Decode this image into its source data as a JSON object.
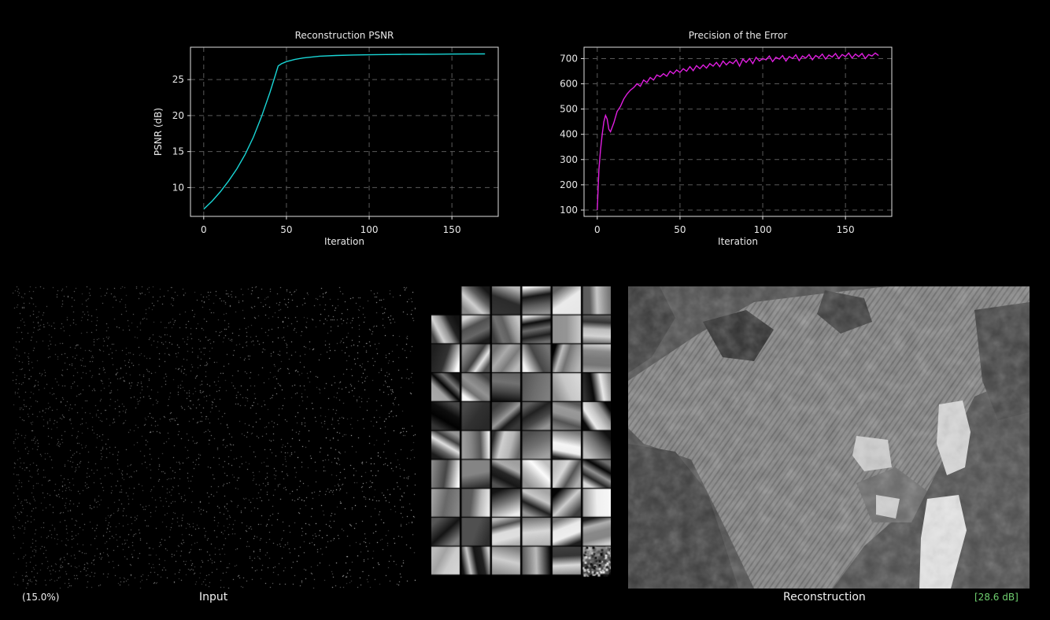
{
  "colors": {
    "psnr_line": "#19d6d6",
    "precision_line": "#e01ee0",
    "psnr_value_text": "#6fcf6f"
  },
  "chart_data": [
    {
      "type": "line",
      "title": "Reconstruction PSNR",
      "xlabel": "Iteration",
      "ylabel": "PSNR (dB)",
      "xlim": [
        -8,
        178
      ],
      "ylim": [
        6,
        29.5
      ],
      "xticks": [
        0,
        50,
        100,
        150
      ],
      "yticks": [
        10,
        15,
        20,
        25
      ],
      "grid": true,
      "series": [
        {
          "x": [
            0,
            5,
            10,
            15,
            20,
            25,
            30,
            35,
            40,
            43,
            45,
            47,
            50,
            55,
            60,
            70,
            80,
            90,
            100,
            110,
            120,
            130,
            140,
            150,
            160,
            170
          ],
          "y": [
            7,
            8.1,
            9.4,
            10.9,
            12.6,
            14.6,
            17.0,
            19.9,
            23.2,
            25.4,
            26.9,
            27.2,
            27.5,
            27.8,
            28.0,
            28.25,
            28.35,
            28.42,
            28.45,
            28.48,
            28.5,
            28.52,
            28.53,
            28.55,
            28.56,
            28.57
          ]
        }
      ]
    },
    {
      "type": "line",
      "title": "Precision of the Error",
      "xlabel": "Iteration",
      "ylabel": "",
      "xlim": [
        -8,
        178
      ],
      "ylim": [
        75,
        745
      ],
      "xticks": [
        0,
        50,
        100,
        150
      ],
      "yticks": [
        100,
        200,
        300,
        400,
        500,
        600,
        700
      ],
      "grid": true,
      "series": [
        {
          "x": [
            0,
            1,
            2,
            3,
            4,
            5,
            6,
            7,
            8,
            10,
            12,
            14,
            16,
            18,
            20,
            22,
            24,
            26,
            28,
            30,
            32,
            34,
            36,
            38,
            40,
            42,
            44,
            46,
            48,
            50,
            52,
            54,
            56,
            58,
            60,
            62,
            64,
            66,
            68,
            70,
            72,
            74,
            76,
            78,
            80,
            82,
            84,
            86,
            88,
            90,
            92,
            94,
            96,
            98,
            100,
            102,
            104,
            106,
            108,
            110,
            112,
            114,
            116,
            118,
            120,
            122,
            124,
            126,
            128,
            130,
            132,
            134,
            136,
            138,
            140,
            142,
            144,
            146,
            148,
            150,
            152,
            154,
            156,
            158,
            160,
            162,
            164,
            166,
            168,
            170
          ],
          "y": [
            100,
            260,
            340,
            400,
            450,
            475,
            460,
            420,
            410,
            445,
            490,
            510,
            540,
            560,
            575,
            585,
            600,
            590,
            615,
            605,
            625,
            615,
            635,
            628,
            640,
            630,
            650,
            640,
            655,
            645,
            660,
            650,
            668,
            652,
            672,
            660,
            675,
            662,
            680,
            670,
            685,
            668,
            690,
            675,
            688,
            680,
            695,
            670,
            698,
            685,
            700,
            680,
            705,
            690,
            700,
            695,
            710,
            688,
            705,
            698,
            712,
            690,
            708,
            700,
            715,
            692,
            710,
            702,
            716,
            695,
            712,
            704,
            718,
            698,
            714,
            706,
            720,
            700,
            716,
            708,
            722,
            702,
            718,
            708,
            720,
            700,
            716,
            710,
            722,
            712
          ]
        }
      ]
    }
  ],
  "footer": {
    "sampling_percent": "(15.0%)",
    "input_label": "Input",
    "reconstruction_label": "Reconstruction",
    "psnr_value": "[28.6 dB]"
  }
}
